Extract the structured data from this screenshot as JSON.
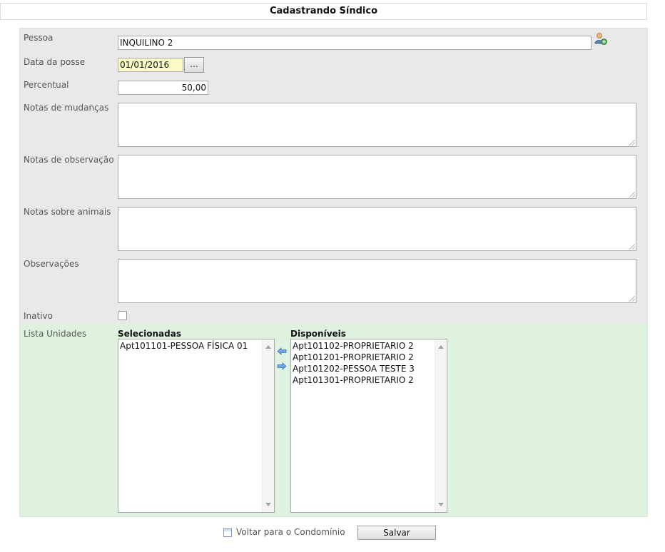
{
  "page": {
    "title": "Cadastrando Síndico"
  },
  "form": {
    "pessoa": {
      "label": "Pessoa",
      "value": "INQUILINO 2",
      "add_icon": "add-person-icon"
    },
    "data_posse": {
      "label": "Data da posse",
      "value": "01/01/2016",
      "picker_label": "..."
    },
    "percentual": {
      "label": "Percentual",
      "value": "50,00"
    },
    "notas_mudancas": {
      "label": "Notas de mudanças",
      "value": ""
    },
    "notas_observacao": {
      "label": "Notas de observação",
      "value": ""
    },
    "notas_animais": {
      "label": "Notas sobre animais",
      "value": ""
    },
    "observacoes": {
      "label": "Observações",
      "value": ""
    },
    "inativo": {
      "label": "Inativo",
      "checked": false
    }
  },
  "unidades": {
    "label": "Lista Unidades",
    "selecionadas": {
      "header": "Selecionadas",
      "items": [
        "Apt101101-PESSOA FÍSICA 01"
      ]
    },
    "disponiveis": {
      "header": "Disponíveis",
      "items": [
        "Apt101102-PROPRIETARIO 2",
        "Apt101201-PROPRIETARIO 2",
        "Apt101202-PESSOA TESTE 3",
        "Apt101301-PROPRIETARIO 2"
      ]
    },
    "move_left_icon": "arrow-left-icon",
    "move_right_icon": "arrow-right-icon"
  },
  "footer": {
    "back_label": "Voltar para o Condomínio",
    "back_icon": "calendar-icon",
    "save_label": "Salvar"
  },
  "colors": {
    "form_bg": "#e9e9e9",
    "list_bg": "#dff2df",
    "date_input_bg": "#fbfbc8"
  }
}
